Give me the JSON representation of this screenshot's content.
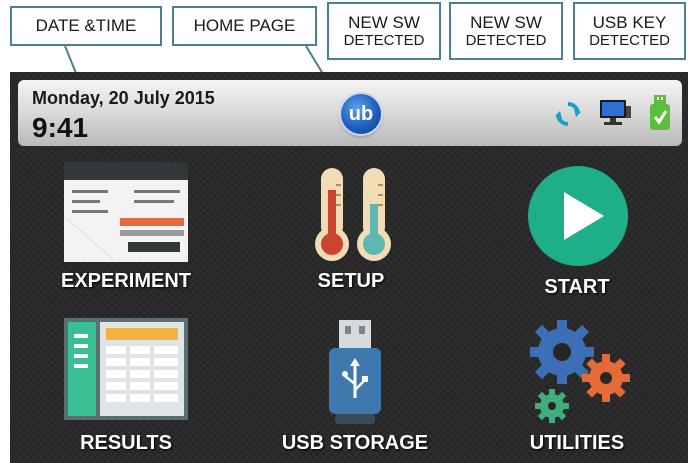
{
  "callouts": {
    "date_time": "DATE &TIME",
    "home_page": "HOME PAGE",
    "new_sw_1": {
      "line1": "NEW SW",
      "line2": "DETECTED"
    },
    "new_sw_2": {
      "line1": "NEW SW",
      "line2": "DETECTED"
    },
    "usb_key": {
      "line1": "USB KEY",
      "line2": "DETECTED"
    }
  },
  "status_bar": {
    "date": "Monday, 20 July 2015",
    "time": "9:41",
    "home_logo": "ub",
    "icons": [
      "sync-icon",
      "computer-icon",
      "usb-key-check-icon"
    ]
  },
  "tiles": [
    {
      "label": "EXPERIMENT",
      "icon": "experiment-form-icon"
    },
    {
      "label": "SETUP",
      "icon": "thermometers-icon"
    },
    {
      "label": "START",
      "icon": "play-icon"
    },
    {
      "label": "RESULTS",
      "icon": "results-table-icon"
    },
    {
      "label": "USB STORAGE",
      "icon": "usb-drive-icon"
    },
    {
      "label": "UTILITIES",
      "icon": "gears-icon"
    }
  ],
  "colors": {
    "callout_border": "#4a7f8e",
    "start_green": "#1fae8a",
    "screen_bg": "#262626"
  }
}
